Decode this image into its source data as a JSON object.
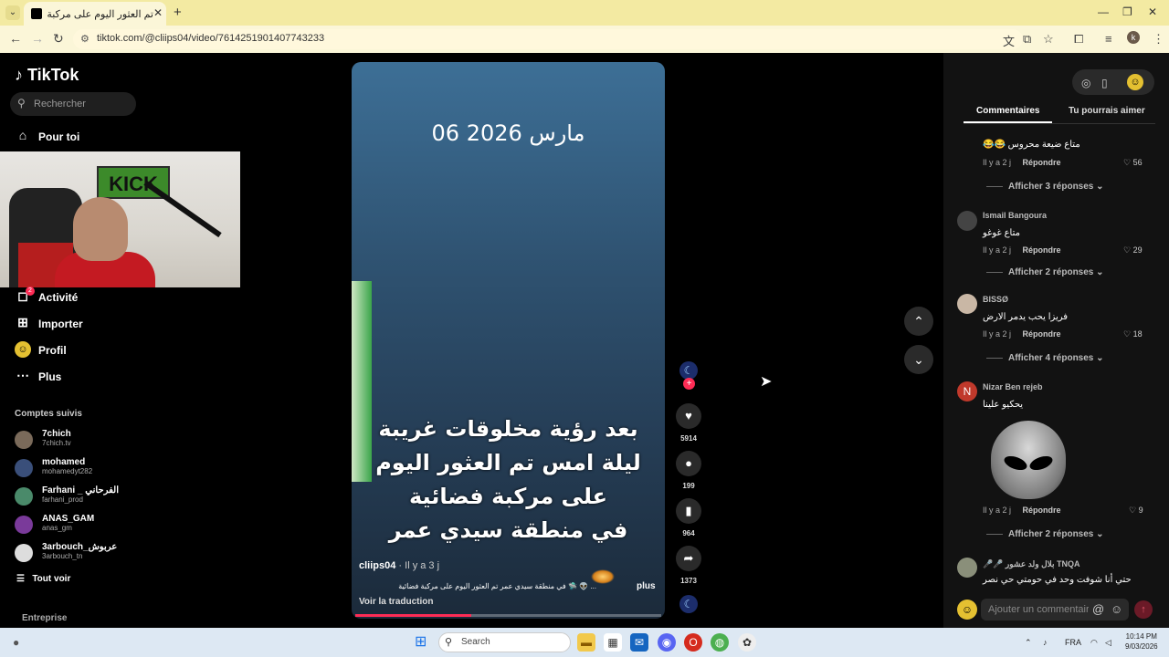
{
  "browser": {
    "tab_title": "تم العثور اليوم على مركبة فضـ",
    "new_tab": "+",
    "url": "tiktok.com/@cliips04/video/7614251901407743233"
  },
  "sidebar": {
    "logo": "TikTok",
    "search_placeholder": "Rechercher",
    "nav": {
      "for_you": "Pour toi",
      "activity": "Activité",
      "activity_badge": "2",
      "upload": "Importer",
      "profile": "Profil",
      "more": "Plus"
    },
    "webcam_banner": "KICK",
    "following_heading": "Comptes suivis",
    "accounts": [
      {
        "name": "7chich",
        "handle": "7chich.tv",
        "color": "#7a6a5a"
      },
      {
        "name": "mohamed",
        "handle": "mohamedyt282",
        "color": "#3a4f7a"
      },
      {
        "name": "Farhani _ الفرحاني",
        "handle": "farhani_prod",
        "color": "#4a8a6a"
      },
      {
        "name": "ANAS_GAM",
        "handle": "anas_gm",
        "color": "#7a3a9a"
      },
      {
        "name": "3arbouch_عربوش",
        "handle": "3arbouch_tn",
        "color": "#ddd"
      }
    ],
    "see_all": "Tout voir",
    "business": "Entreprise"
  },
  "video": {
    "date_overlay": "06 مارس 2026",
    "caption_lines": [
      "بعد رؤية مخلوقات غريبة",
      "ليلة امس تم العثور اليوم",
      "على مركبة فضائية",
      "في منطقة سيدي عمر"
    ],
    "author": "cliips04",
    "time_ago": "· Il y a 3 j",
    "description": "... 👽 🛸 في منطقة سيدي عمر تم العثور اليوم على مركبة فضائية",
    "more": "plus",
    "translate": "Voir la traduction",
    "progress": 0.38
  },
  "actions": {
    "likes": "5914",
    "comments": "199",
    "saves": "964",
    "shares": "1373"
  },
  "panel": {
    "tab_comments": "Commentaires",
    "tab_like": "Tu pourrais aimer",
    "comments": [
      {
        "user": "",
        "text": "متاع ضيعة محروس 😂😂",
        "meta": "Il y a 2 j",
        "reply": "Répondre",
        "likes": "56",
        "replies": "Afficher 3 réponses"
      },
      {
        "user": "Ismail Bangoura",
        "text": "متاع غوغو",
        "meta": "Il y a 2 j",
        "reply": "Répondre",
        "likes": "29",
        "replies": "Afficher 2 réponses"
      },
      {
        "user": "BISSØ",
        "text": "فريزا يحب يدمر الارض",
        "meta": "Il y a 2 j",
        "reply": "Répondre",
        "likes": "18",
        "replies": "Afficher 4 réponses"
      },
      {
        "user": "Nizar Ben rejeb",
        "avatar_letter": "N",
        "text": "يحكيو علينا",
        "meta": "Il y a 2 j",
        "reply": "Répondre",
        "likes": "9",
        "replies": "Afficher 2 réponses"
      },
      {
        "user": "TNQA بلال ولد عشور 🎤🎤",
        "text": "حتي أنا شوفت وحد في حومتي حي نصر"
      }
    ],
    "add_comment_placeholder": "Ajouter un commentaire...",
    "at": "@"
  },
  "taskbar": {
    "search": "Search",
    "lang": "FRA",
    "time": "10:14 PM",
    "date": "9/03/2026"
  }
}
